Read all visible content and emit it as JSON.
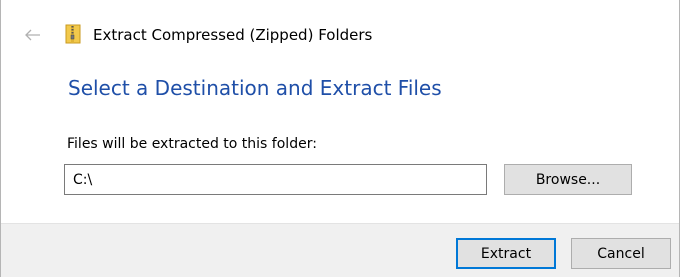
{
  "window": {
    "title": "Extract Compressed (Zipped) Folders",
    "icons": {
      "back": "back-arrow-icon",
      "app": "zip-folder-icon"
    }
  },
  "main": {
    "heading": "Select a Destination and Extract Files",
    "folder_label": "Files will be extracted to this folder:",
    "path_value": "C:\\",
    "browse_label": "Browse..."
  },
  "footer": {
    "extract_label": "Extract",
    "cancel_label": "Cancel"
  },
  "colors": {
    "heading": "#1f4fa8",
    "focus_border": "#0078d7",
    "footer_bg": "#f0f0f0"
  }
}
